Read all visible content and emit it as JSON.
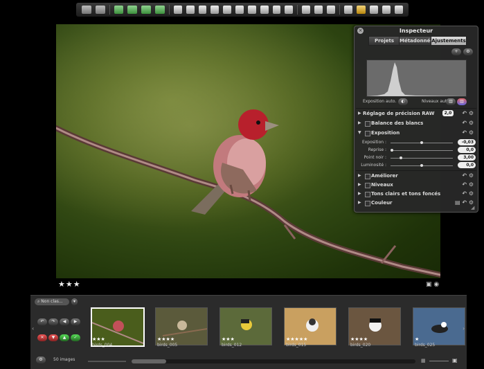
{
  "toolbar": {
    "icons": [
      "view-icon",
      "view-icon",
      "browser-icon",
      "viewer-icon",
      "split-icon",
      "approve-icon",
      "select-icon",
      "rotate-left-icon",
      "rotate-right-icon",
      "stamp-icon",
      "lift-icon",
      "straighten-icon",
      "crop-icon",
      "redeye-icon",
      "brush-icon",
      "spot-icon",
      "project-icon",
      "inspector-icon",
      "metadata-icon",
      "loupe-icon",
      "light-table-icon",
      "info-icon",
      "fullscreen-icon",
      "lock-icon"
    ]
  },
  "photo": {
    "rating": "★★★"
  },
  "inspector": {
    "title": "Inspecteur",
    "tabs": [
      "Projets",
      "Métadonnées",
      "Ajustements"
    ],
    "auto_exposure": "Exposition auto.",
    "auto_levels": "Niveaux auto.",
    "raw": {
      "label": "Réglage de précision RAW",
      "value": "2,0"
    },
    "wb": "Balance des blancs",
    "exposure": {
      "label": "Exposition",
      "sliders": [
        {
          "label": "Exposition :",
          "value": "-0,03",
          "pos": 0.5
        },
        {
          "label": "Reprise :",
          "value": "0,0",
          "pos": 0.0
        },
        {
          "label": "Point noir :",
          "value": "3,00",
          "pos": 0.15
        },
        {
          "label": "Luminosité :",
          "value": "0,0",
          "pos": 0.5
        }
      ]
    },
    "sections": [
      "Améliorer",
      "Niveaux",
      "Tons clairs et tons foncés",
      "Couleur"
    ]
  },
  "browser": {
    "filter": "Non clas...",
    "count": "50 images",
    "thumbs": [
      {
        "name": "birds_004",
        "stars": "★★★",
        "selected": true,
        "bg": "#4a5d1c"
      },
      {
        "name": "birds_005",
        "stars": "★★★★",
        "selected": false,
        "bg": "#5b5a3b"
      },
      {
        "name": "birds_012",
        "stars": "★★★",
        "selected": false,
        "bg": "#5c6a3a"
      },
      {
        "name": "birds_015",
        "stars": "★★★★★",
        "selected": false,
        "bg": "#c9a060"
      },
      {
        "name": "birds_020",
        "stars": "★★★★",
        "selected": false,
        "bg": "#6b5640"
      },
      {
        "name": "birds_025",
        "stars": "★",
        "selected": false,
        "bg": "#4a6a90"
      }
    ]
  }
}
